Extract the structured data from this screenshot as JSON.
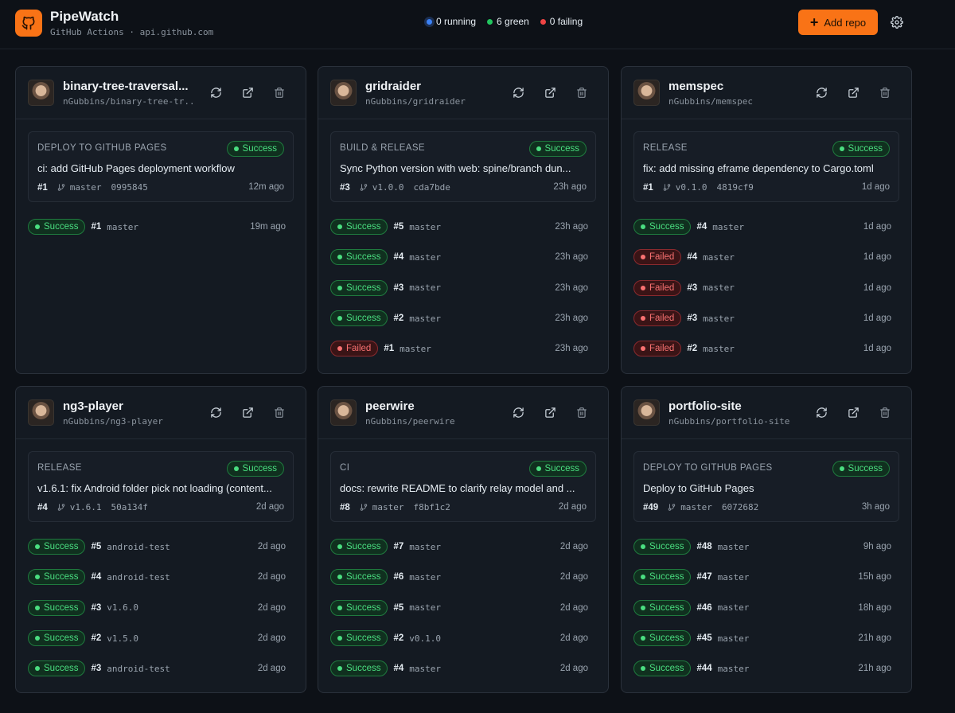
{
  "app": {
    "title": "PipeWatch",
    "subtitle": "GitHub Actions · api.github.com",
    "stats": {
      "running": "0 running",
      "green": "6 green",
      "failing": "0 failing"
    },
    "add_repo_label": "Add repo"
  },
  "colors": {
    "accent": "#f97316",
    "success": "#4ade80",
    "failed": "#f87171",
    "running": "#3b82f6"
  },
  "icons": [
    "github-icon",
    "plus-icon",
    "gear-icon",
    "refresh-icon",
    "external-link-icon",
    "trash-icon",
    "git-branch-icon"
  ],
  "repos": [
    {
      "name": "binary-tree-traversal...",
      "full": "nGubbins/binary-tree-tr...",
      "latest": {
        "workflow": "DEPLOY TO GITHUB PAGES",
        "status": "Success",
        "message": "ci: add GitHub Pages deployment workflow",
        "num": "#1",
        "branch": "master",
        "sha": "0995845",
        "ago": "12m ago"
      },
      "runs": [
        {
          "status": "Success",
          "num": "#1",
          "branch": "master",
          "ago": "19m ago"
        }
      ]
    },
    {
      "name": "gridraider",
      "full": "nGubbins/gridraider",
      "latest": {
        "workflow": "BUILD & RELEASE",
        "status": "Success",
        "message": "Sync Python version with web: spine/branch dun...",
        "num": "#3",
        "branch": "v1.0.0",
        "sha": "cda7bde",
        "ago": "23h ago"
      },
      "runs": [
        {
          "status": "Success",
          "num": "#5",
          "branch": "master",
          "ago": "23h ago"
        },
        {
          "status": "Success",
          "num": "#4",
          "branch": "master",
          "ago": "23h ago"
        },
        {
          "status": "Success",
          "num": "#3",
          "branch": "master",
          "ago": "23h ago"
        },
        {
          "status": "Success",
          "num": "#2",
          "branch": "master",
          "ago": "23h ago"
        },
        {
          "status": "Failed",
          "num": "#1",
          "branch": "master",
          "ago": "23h ago"
        }
      ]
    },
    {
      "name": "memspec",
      "full": "nGubbins/memspec",
      "latest": {
        "workflow": "RELEASE",
        "status": "Success",
        "message": "fix: add missing eframe dependency to Cargo.toml",
        "num": "#1",
        "branch": "v0.1.0",
        "sha": "4819cf9",
        "ago": "1d ago"
      },
      "runs": [
        {
          "status": "Success",
          "num": "#4",
          "branch": "master",
          "ago": "1d ago"
        },
        {
          "status": "Failed",
          "num": "#4",
          "branch": "master",
          "ago": "1d ago"
        },
        {
          "status": "Failed",
          "num": "#3",
          "branch": "master",
          "ago": "1d ago"
        },
        {
          "status": "Failed",
          "num": "#3",
          "branch": "master",
          "ago": "1d ago"
        },
        {
          "status": "Failed",
          "num": "#2",
          "branch": "master",
          "ago": "1d ago"
        }
      ]
    },
    {
      "name": "ng3-player",
      "full": "nGubbins/ng3-player",
      "latest": {
        "workflow": "RELEASE",
        "status": "Success",
        "message": "v1.6.1: fix Android folder pick not loading (content...",
        "num": "#4",
        "branch": "v1.6.1",
        "sha": "50a134f",
        "ago": "2d ago"
      },
      "runs": [
        {
          "status": "Success",
          "num": "#5",
          "branch": "android-test",
          "ago": "2d ago"
        },
        {
          "status": "Success",
          "num": "#4",
          "branch": "android-test",
          "ago": "2d ago"
        },
        {
          "status": "Success",
          "num": "#3",
          "branch": "v1.6.0",
          "ago": "2d ago"
        },
        {
          "status": "Success",
          "num": "#2",
          "branch": "v1.5.0",
          "ago": "2d ago"
        },
        {
          "status": "Success",
          "num": "#3",
          "branch": "android-test",
          "ago": "2d ago"
        }
      ]
    },
    {
      "name": "peerwire",
      "full": "nGubbins/peerwire",
      "latest": {
        "workflow": "CI",
        "status": "Success",
        "message": "docs: rewrite README to clarify relay model and ...",
        "num": "#8",
        "branch": "master",
        "sha": "f8bf1c2",
        "ago": "2d ago"
      },
      "runs": [
        {
          "status": "Success",
          "num": "#7",
          "branch": "master",
          "ago": "2d ago"
        },
        {
          "status": "Success",
          "num": "#6",
          "branch": "master",
          "ago": "2d ago"
        },
        {
          "status": "Success",
          "num": "#5",
          "branch": "master",
          "ago": "2d ago"
        },
        {
          "status": "Success",
          "num": "#2",
          "branch": "v0.1.0",
          "ago": "2d ago"
        },
        {
          "status": "Success",
          "num": "#4",
          "branch": "master",
          "ago": "2d ago"
        }
      ]
    },
    {
      "name": "portfolio-site",
      "full": "nGubbins/portfolio-site",
      "latest": {
        "workflow": "DEPLOY TO GITHUB PAGES",
        "status": "Success",
        "message": "Deploy to GitHub Pages",
        "num": "#49",
        "branch": "master",
        "sha": "6072682",
        "ago": "3h ago"
      },
      "runs": [
        {
          "status": "Success",
          "num": "#48",
          "branch": "master",
          "ago": "9h ago"
        },
        {
          "status": "Success",
          "num": "#47",
          "branch": "master",
          "ago": "15h ago"
        },
        {
          "status": "Success",
          "num": "#46",
          "branch": "master",
          "ago": "18h ago"
        },
        {
          "status": "Success",
          "num": "#45",
          "branch": "master",
          "ago": "21h ago"
        },
        {
          "status": "Success",
          "num": "#44",
          "branch": "master",
          "ago": "21h ago"
        }
      ]
    }
  ]
}
